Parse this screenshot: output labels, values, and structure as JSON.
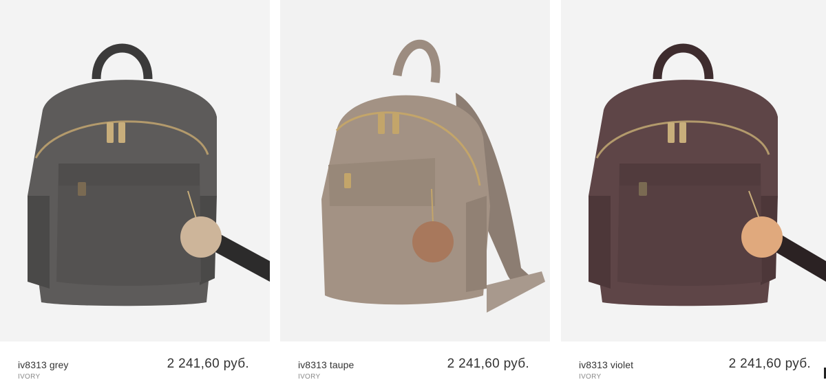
{
  "products": [
    {
      "name": "iv8313 grey",
      "brand": "IVORY",
      "price": "2 241,60 руб.",
      "image_alt": "grey backpack",
      "colors": {
        "body": "#5d5b5a",
        "body_dark": "#3f3e3d",
        "pompom": "#cdb59a",
        "bg": "#f3f3f3"
      }
    },
    {
      "name": "iv8313 taupe",
      "brand": "IVORY",
      "price": "2 241,60 руб.",
      "image_alt": "taupe backpack",
      "colors": {
        "body": "#a39284",
        "body_dark": "#86776b",
        "pompom": "#a8785c",
        "bg": "#f2f2f2"
      }
    },
    {
      "name": "iv8313 violet",
      "brand": "IVORY",
      "price": "2 241,60 руб.",
      "image_alt": "violet backpack",
      "colors": {
        "body": "#5e4547",
        "body_dark": "#432f31",
        "pompom": "#e0a97d",
        "bg": "#f3f3f3"
      }
    }
  ]
}
